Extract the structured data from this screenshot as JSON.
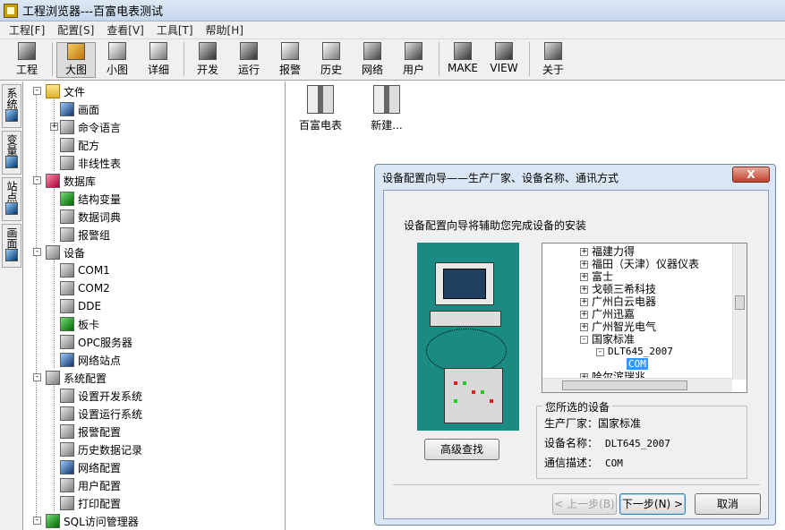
{
  "window": {
    "title": "工程浏览器---百富电表测试"
  },
  "menu": [
    "工程[F]",
    "配置[S]",
    "查看[V]",
    "工具[T]",
    "帮助[H]"
  ],
  "toolbar": [
    {
      "label": "工程",
      "icon": "project-icon"
    },
    {
      "label": "大图",
      "icon": "large-icons-icon"
    },
    {
      "label": "小图",
      "icon": "small-icons-icon"
    },
    {
      "label": "详细",
      "icon": "details-icon"
    },
    {
      "label": "开发",
      "icon": "develop-icon"
    },
    {
      "label": "运行",
      "icon": "run-icon"
    },
    {
      "label": "报警",
      "icon": "alarm-icon"
    },
    {
      "label": "历史",
      "icon": "history-icon"
    },
    {
      "label": "网络",
      "icon": "network-icon"
    },
    {
      "label": "用户",
      "icon": "user-key-icon"
    },
    {
      "label": "MAKE",
      "icon": "make-icon"
    },
    {
      "label": "VIEW",
      "icon": "view-icon"
    },
    {
      "label": "关于",
      "icon": "about-icon"
    }
  ],
  "side_tabs": [
    "系统",
    "变量",
    "站点",
    "画面"
  ],
  "tree": [
    {
      "label": "文件",
      "expander": "-"
    },
    {
      "label": "画面"
    },
    {
      "label": "命令语言",
      "expander": "+"
    },
    {
      "label": "配方"
    },
    {
      "label": "非线性表"
    },
    {
      "label": "数据库",
      "expander": "-"
    },
    {
      "label": "结构变量"
    },
    {
      "label": "数据词典"
    },
    {
      "label": "报警组"
    },
    {
      "label": "设备",
      "expander": "-"
    },
    {
      "label": "COM1"
    },
    {
      "label": "COM2"
    },
    {
      "label": "DDE"
    },
    {
      "label": "板卡"
    },
    {
      "label": "OPC服务器"
    },
    {
      "label": "网络站点"
    },
    {
      "label": "系统配置",
      "expander": "-"
    },
    {
      "label": "设置开发系统"
    },
    {
      "label": "设置运行系统"
    },
    {
      "label": "报警配置"
    },
    {
      "label": "历史数据记录"
    },
    {
      "label": "网络配置"
    },
    {
      "label": "用户配置"
    },
    {
      "label": "打印配置"
    },
    {
      "label": "SQL访问管理器",
      "expander": "-"
    }
  ],
  "files": [
    {
      "label": "百富电表"
    },
    {
      "label": "新建..."
    }
  ],
  "dialog": {
    "title": "设备配置向导——生产厂家、设备名称、通讯方式",
    "close": "X",
    "subtitle": "设备配置向导将辅助您完成设备的安装",
    "advanced_button": "高级查找",
    "list": [
      {
        "label": "福建力得",
        "expander": "+"
      },
      {
        "label": "福田（天津）仪器仪表",
        "expander": "+"
      },
      {
        "label": "富士",
        "expander": "+"
      },
      {
        "label": "戈顿三希科技",
        "expander": "+"
      },
      {
        "label": "广州白云电器",
        "expander": "+"
      },
      {
        "label": "广州迅嘉",
        "expander": "+"
      },
      {
        "label": "广州智光电气",
        "expander": "+"
      },
      {
        "label": "国家标准",
        "expander": "-"
      },
      {
        "label": "DLT645_2007",
        "expander": "-"
      },
      {
        "label": "COM",
        "selected": true
      },
      {
        "label": "哈尔滨瑞兆",
        "expander": "+"
      }
    ],
    "selected_group": {
      "title": "您所选的设备",
      "rows": [
        {
          "label": "生产厂家：",
          "value": "国家标准"
        },
        {
          "label": "设备名称：",
          "value": "DLT645_2007"
        },
        {
          "label": "通信描述：",
          "value": "COM"
        }
      ]
    },
    "buttons": {
      "prev": "< 上一步(B)",
      "next": "下一步(N) >",
      "cancel": "取消"
    }
  }
}
